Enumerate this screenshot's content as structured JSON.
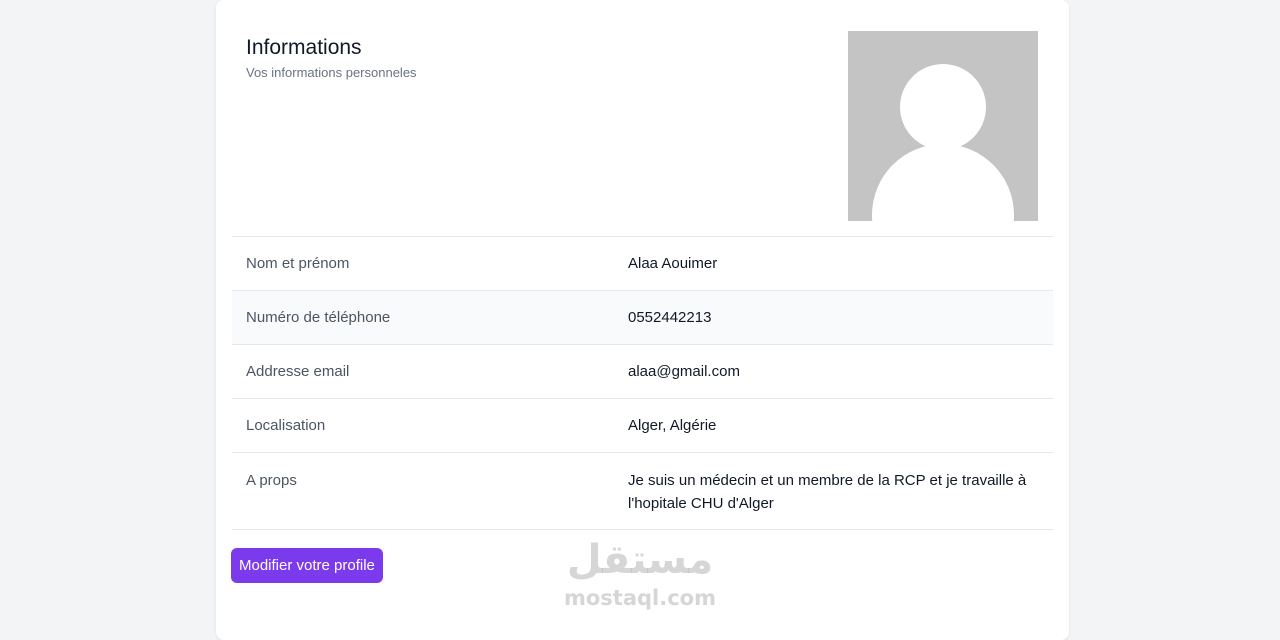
{
  "profile": {
    "title": "Informations",
    "subtitle": "Vos informations personneles",
    "avatar_icon": "user-placeholder-icon",
    "rows": [
      {
        "label": "Nom et prénom",
        "value": "Alaa Aouimer"
      },
      {
        "label": "Numéro de téléphone",
        "value": "0552442213"
      },
      {
        "label": "Addresse email",
        "value": "alaa@gmail.com"
      },
      {
        "label": "Localisation",
        "value": "Alger, Algérie"
      },
      {
        "label": "A props",
        "value": "Je suis un médecin et un membre de la RCP et je travaille à l'hopitale CHU d'Alger"
      }
    ],
    "edit_button_label": "Modifier votre profile"
  },
  "watermark": {
    "arabic": "مستقل",
    "latin": "mostaql.com"
  },
  "colors": {
    "accent": "#7c3aed",
    "background": "#f3f4f6",
    "avatar_bg": "#c4c4c4"
  }
}
